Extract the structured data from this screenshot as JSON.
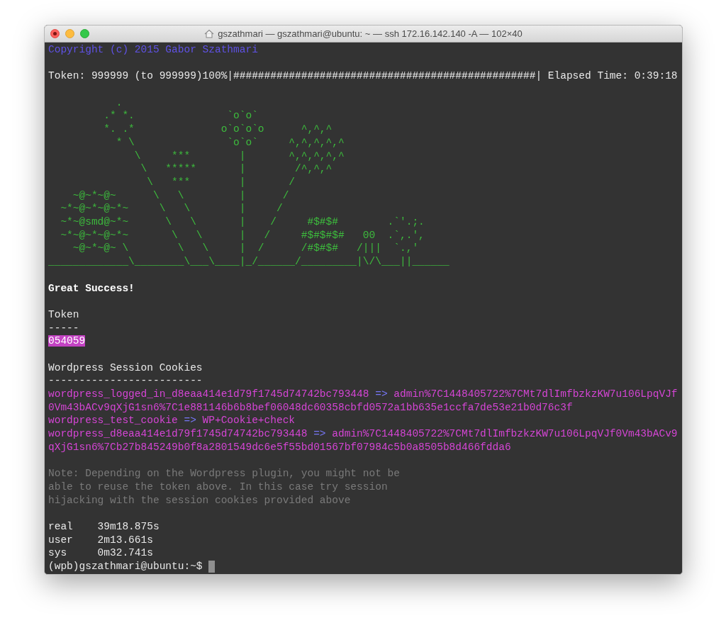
{
  "window": {
    "title": "gszathmari — gszathmari@ubuntu: ~ — ssh 172.16.142.140 -A — 102×40"
  },
  "terminal": {
    "copyright": "Copyright (c) 2015 Gabor Szathmari",
    "progress": "Token: 999999 (to 999999)100%|#################################################| Elapsed Time: 0:39:18",
    "ascii_art": [
      "           .",
      "         .* *.               `o`o`",
      "         *. .*              o`o`o`o      ^,^,^",
      "           * \\               `o`o`     ^,^,^,^,^",
      "              \\     ***        |       ^,^,^,^,^",
      "               \\   *****       |        /^,^,^",
      "                \\   ***        |       /",
      "    ~@~*~@~      \\   \\         |      /",
      "  ~*~@~*~@~*~     \\   \\        |     /",
      "  ~*~@smd@~*~      \\   \\       |    /     #$#$#        .`'.;.",
      "  ~*~@~*~@~*~       \\   \\      |   /     #$#$#$#   00  .`,.',",
      "    ~@~*~@~ \\        \\   \\     |  /      /#$#$#   /|||  `.,'",
      "_____________\\________\\___\\____|_/______/_________|\\/\\___||______"
    ],
    "status": "Great Success!",
    "token_heading": "Token",
    "token_rule": "-----",
    "token": "054059",
    "cookies_heading": "Wordpress Session Cookies",
    "cookies_rule": "-------------------------",
    "cookies": [
      {
        "name": "wordpress_logged_in_d8eaa414e1d79f1745d74742bc793448",
        "arrow": "=>",
        "value": "admin%7C1448405722%7CMt7dlImfbzkzKW7u106LpqVJf0Vm43bACv9qXjG1sn6%7C1e881146b6b8bef06048dc60358cbfd0572a1bb635e1ccfa7de53e21b0d76c3f"
      },
      {
        "name": "wordpress_test_cookie",
        "arrow": "=>",
        "value": "WP+Cookie+check"
      },
      {
        "name": "wordpress_d8eaa414e1d79f1745d74742bc793448",
        "arrow": "=>",
        "value": "admin%7C1448405722%7CMt7dlImfbzkzKW7u106LpqVJf0Vm43bACv9qXjG1sn6%7Cb27b845249b0f8a2801549dc6e5f55bd01567bf07984c5b0a8505b8d466fdda6"
      }
    ],
    "note": [
      "Note: Depending on the Wordpress plugin, you might not be",
      "able to reuse the token above. In this case try session",
      "hijacking with the session cookies provided above"
    ],
    "timings": [
      {
        "label": "real",
        "value": "39m18.875s"
      },
      {
        "label": "user",
        "value": "2m13.661s"
      },
      {
        "label": "sys",
        "value": "0m32.741s"
      }
    ],
    "prompt": "(wpb)gszathmari@ubuntu:~$"
  }
}
